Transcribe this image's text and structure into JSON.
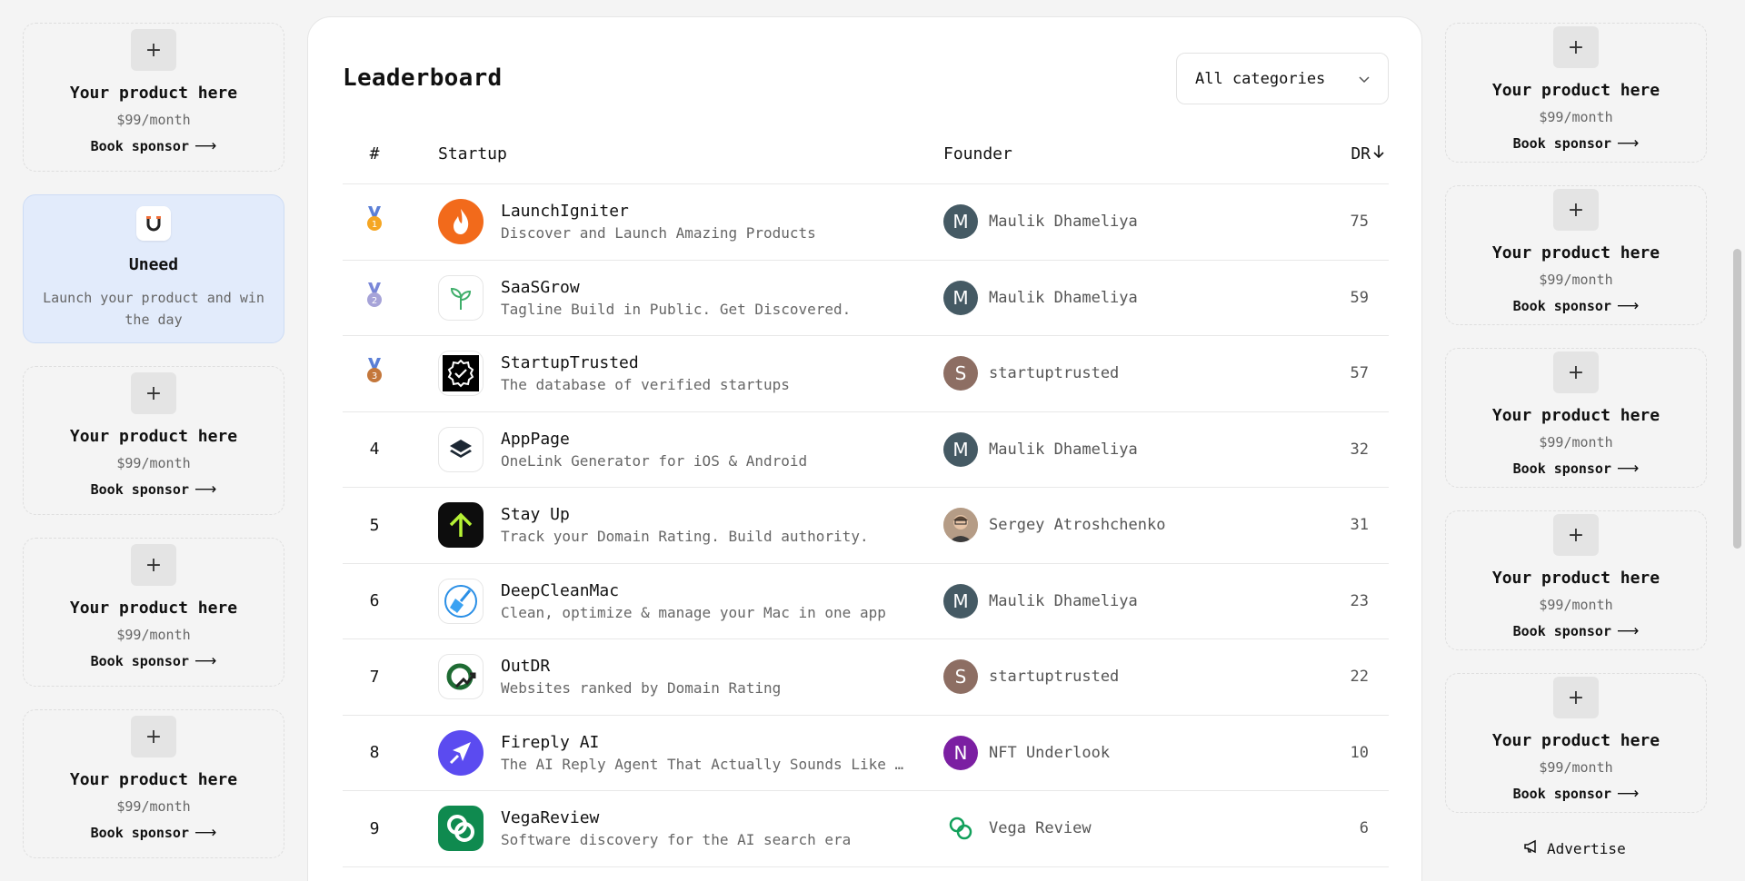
{
  "left_sidebar": {
    "sponsor_slots": [
      {
        "title": "Your product here",
        "price": "$99/month",
        "cta": "Book sponsor"
      },
      {
        "title": "Your product here",
        "price": "$99/month",
        "cta": "Book sponsor"
      },
      {
        "title": "Your product here",
        "price": "$99/month",
        "cta": "Book sponsor"
      },
      {
        "title": "Your product here",
        "price": "$99/month",
        "cta": "Book sponsor"
      }
    ],
    "featured": {
      "title": "Uneed",
      "desc": "Launch your product and win the day",
      "logo_icon": "uneed-logo-icon"
    }
  },
  "main": {
    "title": "Leaderboard",
    "category_select": {
      "value": "All categories",
      "icon": "chevron-down-icon"
    },
    "columns": {
      "rank": "#",
      "startup": "Startup",
      "founder": "Founder",
      "dr": "DR"
    },
    "rows": [
      {
        "rank": "1",
        "medal_color": "#f5a623",
        "ribbon": "#5b7fd6",
        "name": "LaunchIgniter",
        "tagline": "Discover and Launch Amazing Products",
        "logo": "flame-icon",
        "founder": "Maulik Dhameliya",
        "initial": "M",
        "avatar_color": "#455a64",
        "dr": "75"
      },
      {
        "rank": "2",
        "medal_color": "#a6a3d8",
        "ribbon": "#7a87d8",
        "name": "SaaSGrow",
        "tagline": "Tagline Build in Public. Get Discovered.",
        "logo": "sprout-icon",
        "founder": "Maulik Dhameliya",
        "initial": "M",
        "avatar_color": "#455a64",
        "dr": "59"
      },
      {
        "rank": "3",
        "medal_color": "#c4773b",
        "ribbon": "#5b7fd6",
        "name": "StartupTrusted",
        "tagline": "The database of verified startups",
        "logo": "verified-badge-icon",
        "founder": "startuptrusted",
        "initial": "S",
        "avatar_color": "#8d6e63",
        "dr": "57"
      },
      {
        "rank": "4",
        "name": "AppPage",
        "tagline": "OneLink Generator for iOS & Android",
        "logo": "layers-icon",
        "founder": "Maulik Dhameliya",
        "initial": "M",
        "avatar_color": "#455a64",
        "dr": "32"
      },
      {
        "rank": "5",
        "name": "Stay Up",
        "tagline": "Track your Domain Rating. Build authority.",
        "logo": "arrow-up-icon",
        "founder": "Sergey Atroshchenko",
        "initial": "",
        "avatar_color": "#b08a6a",
        "dr": "31"
      },
      {
        "rank": "6",
        "name": "DeepCleanMac",
        "tagline": "Clean, optimize & manage your Mac in one app",
        "logo": "broom-icon",
        "founder": "Maulik Dhameliya",
        "initial": "M",
        "avatar_color": "#455a64",
        "dr": "23"
      },
      {
        "rank": "7",
        "name": "OutDR",
        "tagline": "Websites ranked by Domain Rating",
        "logo": "trend-ring-icon",
        "founder": "startuptrusted",
        "initial": "S",
        "avatar_color": "#8d6e63",
        "dr": "22"
      },
      {
        "rank": "8",
        "name": "Fireply AI",
        "tagline": "The AI Reply Agent That Actually Sounds Like …",
        "logo": "paper-plane-icon",
        "founder": "NFT Underlook",
        "initial": "N",
        "avatar_color": "#7b1fa2",
        "dr": "10"
      },
      {
        "rank": "9",
        "name": "VegaReview",
        "tagline": "Software discovery for the AI search era",
        "logo": "linked-rings-icon",
        "founder": "Vega Review",
        "initial": "",
        "avatar_color": "#ffffff",
        "dr": "6"
      }
    ]
  },
  "right_sidebar": {
    "sponsor_slots": [
      {
        "title": "Your product here",
        "price": "$99/month",
        "cta": "Book sponsor"
      },
      {
        "title": "Your product here",
        "price": "$99/month",
        "cta": "Book sponsor"
      },
      {
        "title": "Your product here",
        "price": "$99/month",
        "cta": "Book sponsor"
      },
      {
        "title": "Your product here",
        "price": "$99/month",
        "cta": "Book sponsor"
      },
      {
        "title": "Your product here",
        "price": "$99/month",
        "cta": "Book sponsor"
      }
    ],
    "advertise": "Advertise"
  }
}
